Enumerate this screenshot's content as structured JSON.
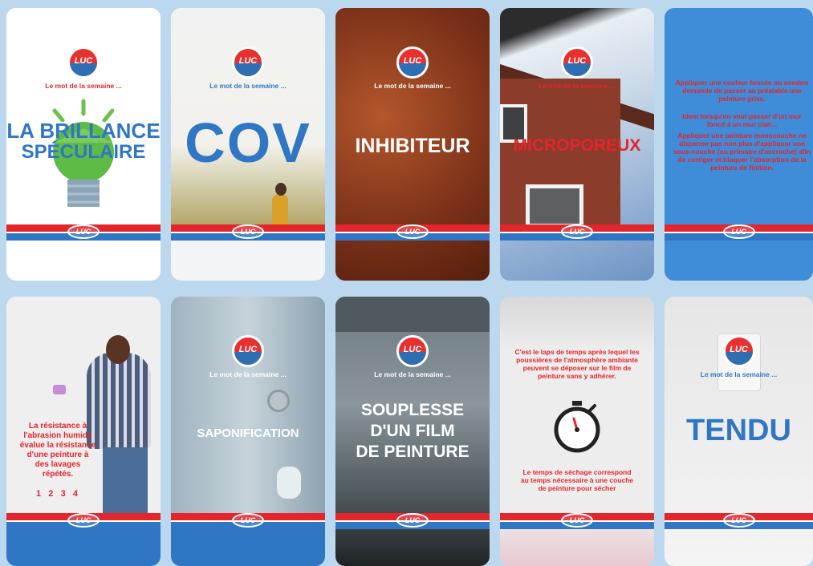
{
  "logo_text": "LUC",
  "tagline": "Le mot de la semaine ...",
  "colors": {
    "brand_red": "#e4252b",
    "brand_blue": "#2f77c4",
    "page_bg": "#bcd8ee"
  },
  "cards": {
    "brillance": {
      "title_line1": "LA BRILLANCE",
      "title_line2": "SPÉCULAIRE",
      "icon": "lightbulb-icon"
    },
    "cov": {
      "title": "COV"
    },
    "inhibiteur": {
      "title": "INHIBITEUR"
    },
    "microporeux": {
      "title": "MICROPOREUX"
    },
    "couleur_foncee": {
      "p1": "Appliquer une couleur foncée ou sombre demande de passer au préalable une peinture grise.",
      "p2": "Idem lorsqu'on veut passer d'un mur foncé à un mur clair...",
      "p3": "Appliquer une peinture monocouche ne dispense pas non plus d'appliquer une sous-couche (ou primaire d'accroche) afin de corriger et bloquer l'absorption de la peinture de finition."
    },
    "abrasion": {
      "text": "La résistance à l'abrasion humide évalue la résistance d'une peinture à des lavages répétés.",
      "numbers": "1   2   3   4"
    },
    "saponification": {
      "title": "SAPONIFICATION"
    },
    "souplesse": {
      "title_line1": "SOUPLESSE",
      "title_line2": "D'UN FILM",
      "title_line3": "DE PEINTURE"
    },
    "laps_temps": {
      "top_text": "C'est le laps de temps après lequel les poussières de l'atmosphère ambiante peuvent se déposer sur le film de peinture sans y adhérer.",
      "bottom_text": "Le temps de séchage correspond au temps nécessaire à une couche de peinture pour sécher",
      "icon": "stopwatch-icon"
    },
    "tendu": {
      "title": "TENDU"
    }
  }
}
